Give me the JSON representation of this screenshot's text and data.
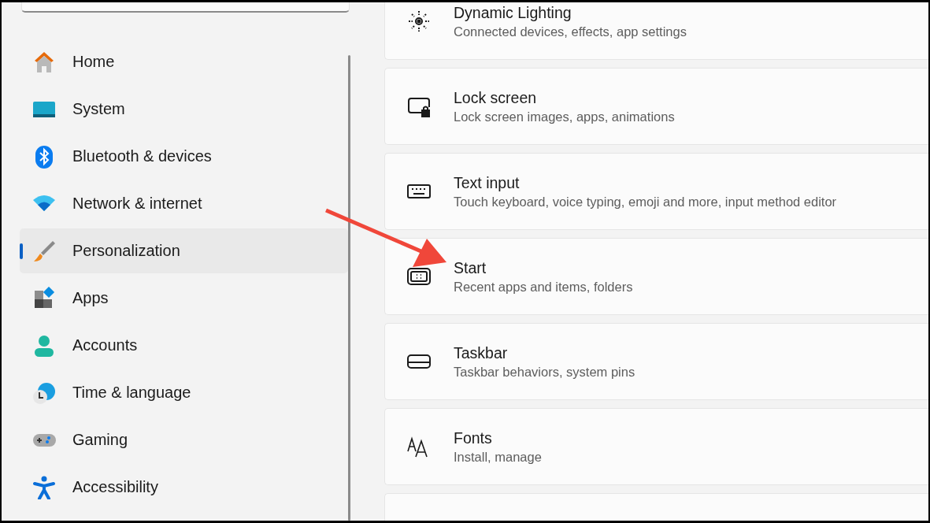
{
  "sidebar": {
    "items": [
      {
        "label": "Home",
        "selected": false
      },
      {
        "label": "System",
        "selected": false
      },
      {
        "label": "Bluetooth & devices",
        "selected": false
      },
      {
        "label": "Network & internet",
        "selected": false
      },
      {
        "label": "Personalization",
        "selected": true
      },
      {
        "label": "Apps",
        "selected": false
      },
      {
        "label": "Accounts",
        "selected": false
      },
      {
        "label": "Time & language",
        "selected": false
      },
      {
        "label": "Gaming",
        "selected": false
      },
      {
        "label": "Accessibility",
        "selected": false
      }
    ]
  },
  "settings": [
    {
      "title": "Dynamic Lighting",
      "description": "Connected devices, effects, app settings"
    },
    {
      "title": "Lock screen",
      "description": "Lock screen images, apps, animations"
    },
    {
      "title": "Text input",
      "description": "Touch keyboard, voice typing, emoji and more, input method editor"
    },
    {
      "title": "Start",
      "description": "Recent apps and items, folders"
    },
    {
      "title": "Taskbar",
      "description": "Taskbar behaviors, system pins"
    },
    {
      "title": "Fonts",
      "description": "Install, manage"
    }
  ]
}
